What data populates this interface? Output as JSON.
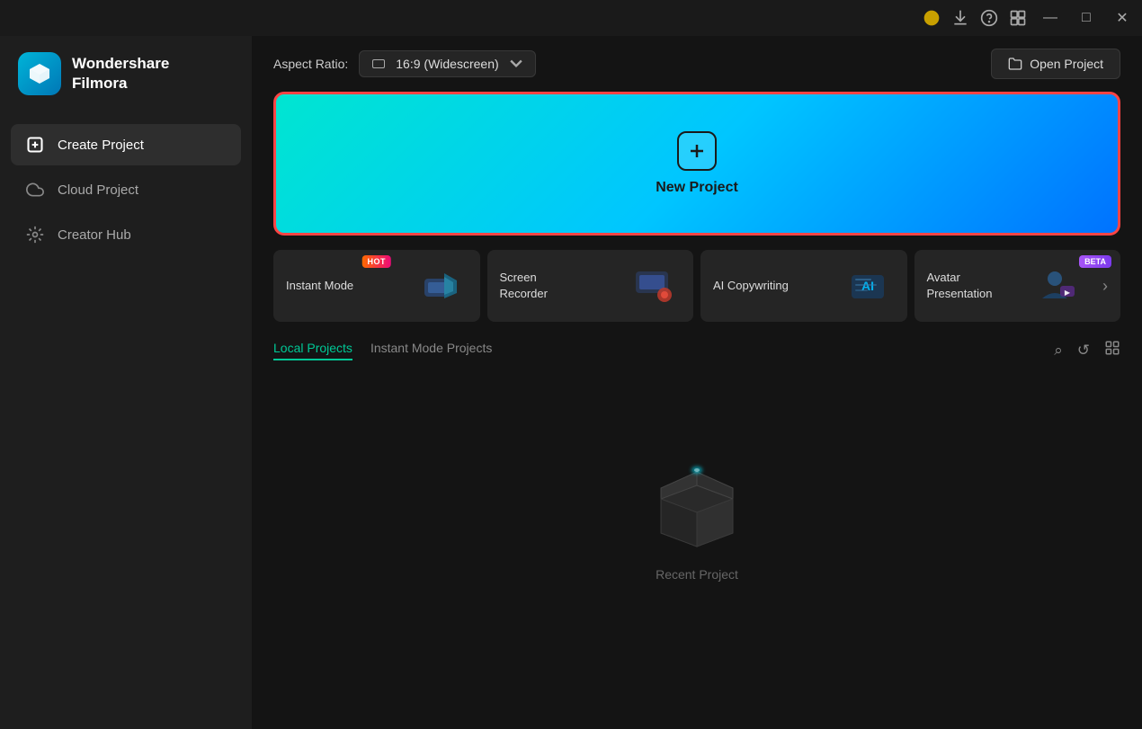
{
  "app": {
    "name": "Wondershare",
    "name2": "Filmora",
    "logo_alt": "Filmora logo"
  },
  "titlebar": {
    "minimize_label": "minimize",
    "maximize_label": "maximize",
    "close_label": "close"
  },
  "sidebar": {
    "items": [
      {
        "id": "create-project",
        "label": "Create Project",
        "active": true
      },
      {
        "id": "cloud-project",
        "label": "Cloud Project",
        "active": false
      },
      {
        "id": "creator-hub",
        "label": "Creator Hub",
        "active": false
      }
    ]
  },
  "header": {
    "aspect_ratio_label": "Aspect Ratio:",
    "aspect_ratio_value": "16:9 (Widescreen)",
    "open_project_label": "Open Project"
  },
  "new_project": {
    "label": "New Project"
  },
  "quick_cards": [
    {
      "id": "instant-mode",
      "label": "Instant Mode",
      "badge": "HOT"
    },
    {
      "id": "screen-recorder",
      "label": "Screen Recorder",
      "badge": ""
    },
    {
      "id": "ai-copywriting",
      "label": "AI Copywriting",
      "badge": ""
    },
    {
      "id": "avatar-presentation",
      "label": "Avatar Presentation",
      "badge": "BETA"
    }
  ],
  "projects": {
    "tabs": [
      {
        "id": "local-projects",
        "label": "Local Projects",
        "active": true
      },
      {
        "id": "instant-mode-projects",
        "label": "Instant Mode Projects",
        "active": false
      }
    ],
    "empty_label": "Recent Project"
  }
}
